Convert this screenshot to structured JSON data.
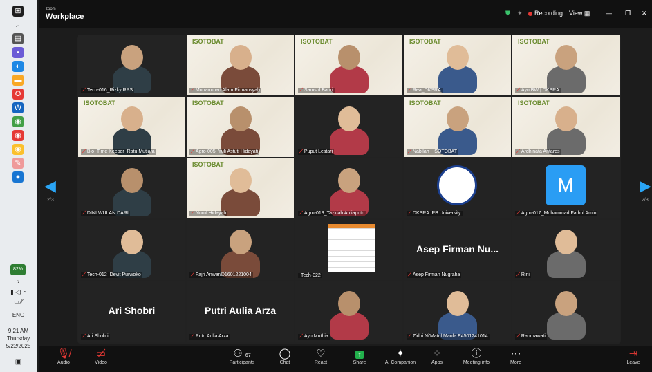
{
  "taskbar": {
    "time": "9:21 AM",
    "day": "Thursday",
    "date": "5/22/2025",
    "language": "ENG",
    "battery_badge": "82%"
  },
  "window": {
    "brand_top": "zoom",
    "brand_main": "Workplace",
    "recording_label": "Recording",
    "view_label": "View"
  },
  "page": {
    "indicator": "2/3"
  },
  "participants": [
    {
      "name": "Tech-016_Rizky RPS",
      "big": ""
    },
    {
      "name": "Muhammad Alam Firmansyah",
      "big": ""
    },
    {
      "name": "Samsul Bahri",
      "big": ""
    },
    {
      "name": "Rea_DKSRA",
      "big": ""
    },
    {
      "name": "Ayu BW | DKSRA",
      "big": ""
    },
    {
      "name": "Bio_Time Keeper_Ratu Mutiara",
      "big": ""
    },
    {
      "name": "Agro-005_Yuli Astuti Hidayati",
      "big": ""
    },
    {
      "name": "Puput Lestari",
      "big": ""
    },
    {
      "name": "Nabilah | ISOTOBAT",
      "big": ""
    },
    {
      "name": "Ardhinata Antares",
      "big": ""
    },
    {
      "name": "DINI WULAN DARI",
      "big": ""
    },
    {
      "name": "Nurul Hidayah",
      "big": ""
    },
    {
      "name": "Agro-013_Tazkiah Auliaputri",
      "big": ""
    },
    {
      "name": "DKSRA IPB University",
      "big": ""
    },
    {
      "name": "Agro-017_Muhammad Fathul Amin",
      "big": "M"
    },
    {
      "name": "Tech-012_Devit Purwoko",
      "big": ""
    },
    {
      "name": "Fajri Anwar/D1601221004",
      "big": ""
    },
    {
      "name": "Tech-022",
      "big": ""
    },
    {
      "name": "Asep Firman Nugraha",
      "big": "Asep Firman Nu..."
    },
    {
      "name": "Rini",
      "big": ""
    },
    {
      "name": "Ari Shobri",
      "big": "Ari Shobri"
    },
    {
      "name": "Putri Aulia Arza",
      "big": "Putri Aulia Arza"
    },
    {
      "name": "Ayu Muthia",
      "big": ""
    },
    {
      "name": "Zidni Ni'Matul Maula E4501241014",
      "big": ""
    },
    {
      "name": "Rahmawati",
      "big": ""
    }
  ],
  "banner_logo": "ISOTOBAT",
  "toolbar": {
    "audio": "Audio",
    "video": "Video",
    "participants": "Participants",
    "participants_count": "67",
    "chat": "Chat",
    "react": "React",
    "share": "Share",
    "ai_companion": "AI Companion",
    "apps": "Apps",
    "meeting_info": "Meeting info",
    "more": "More",
    "leave": "Leave"
  },
  "colors": {
    "accent": "#2aa4f4",
    "recording": "#e53935",
    "share_green": "#22b14c"
  }
}
